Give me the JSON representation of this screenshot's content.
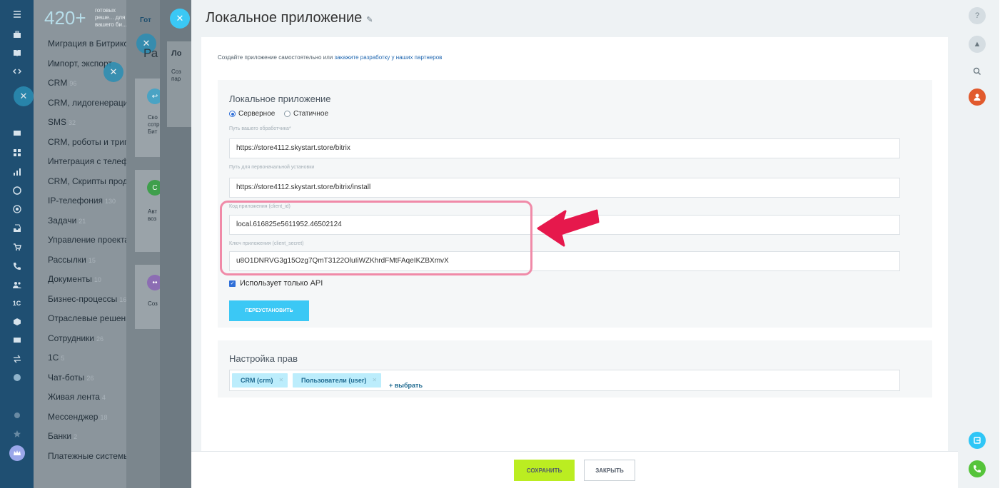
{
  "market": {
    "count": "420+",
    "count_sub": "готовых реше... для вашего би...",
    "categories": [
      {
        "label": "Миграция в Битрикс",
        "n": ""
      },
      {
        "label": "Импорт, экспорт",
        "n": ""
      },
      {
        "label": "CRM",
        "n": "96"
      },
      {
        "label": "CRM, лидогенерация",
        "n": ""
      },
      {
        "label": "SMS",
        "n": "32"
      },
      {
        "label": "CRM, роботы и триггеры",
        "n": ""
      },
      {
        "label": "Интеграция с телефонией",
        "n": ""
      },
      {
        "label": "CRM, Скрипты продаж",
        "n": ""
      },
      {
        "label": "IP-телефония",
        "n": "130"
      },
      {
        "label": "Задачи",
        "n": "21"
      },
      {
        "label": "Управление проектами",
        "n": ""
      },
      {
        "label": "Рассылки",
        "n": "15"
      },
      {
        "label": "Документы",
        "n": "10"
      },
      {
        "label": "Бизнес-процессы",
        "n": "16"
      },
      {
        "label": "Отраслевые решения",
        "n": ""
      },
      {
        "label": "Сотрудники",
        "n": "26"
      },
      {
        "label": "1С",
        "n": "5"
      },
      {
        "label": "Чат-боты",
        "n": "26"
      },
      {
        "label": "Живая лента",
        "n": "4"
      },
      {
        "label": "Мессенджер",
        "n": "18"
      },
      {
        "label": "Банки",
        "n": "2"
      },
      {
        "label": "Платежные системы",
        "n": ""
      }
    ]
  },
  "layer2": {
    "tab": "Гот",
    "fragment_ra": "Ра",
    "card1_title": "Ло",
    "card1_text": "Соз\nпар",
    "card2_text": "Ско\nсотр\nБит",
    "card3_text": "Авт\nвоз",
    "card4_text": "Соз"
  },
  "slider": {
    "title": "Локальное приложение",
    "intro_text": "Создайте приложение самостоятельно или ",
    "intro_link": "закажите разработку у наших партнеров",
    "section_title": "Локальное приложение",
    "radio_server": "Серверное",
    "radio_static": "Статичное",
    "handler_label": "Путь вашего обработчика*",
    "handler_value": "https://store4112.skystart.store/bitrix",
    "install_label": "Путь для первоначальной установки",
    "install_value": "https://store4112.skystart.store/bitrix/install",
    "client_id_label": "Код приложения (client_id)",
    "client_id_value": "local.616825e5611952.46502124",
    "client_secret_label": "Ключ приложения (client_secret)",
    "client_secret_value": "u8O1DNRVG3g15Ozg7QmT3122OluIiWZKhrdFMtFAqeIKZBXmvX",
    "api_only_label": "Использует только API",
    "reinstall_button": "ПЕРЕУСТАНОВИТЬ",
    "rights_title": "Настройка прав",
    "rights_tags": [
      "CRM (crm)",
      "Пользователи (user)"
    ],
    "rights_add": "+ выбрать",
    "save_button": "СОХРАНИТЬ",
    "close_button": "ЗАКРЫТЬ"
  },
  "colors": {
    "accent": "#3bc8f5",
    "save": "#bbed21",
    "highlight": "#f08aa8",
    "arrow": "#e6184c"
  }
}
